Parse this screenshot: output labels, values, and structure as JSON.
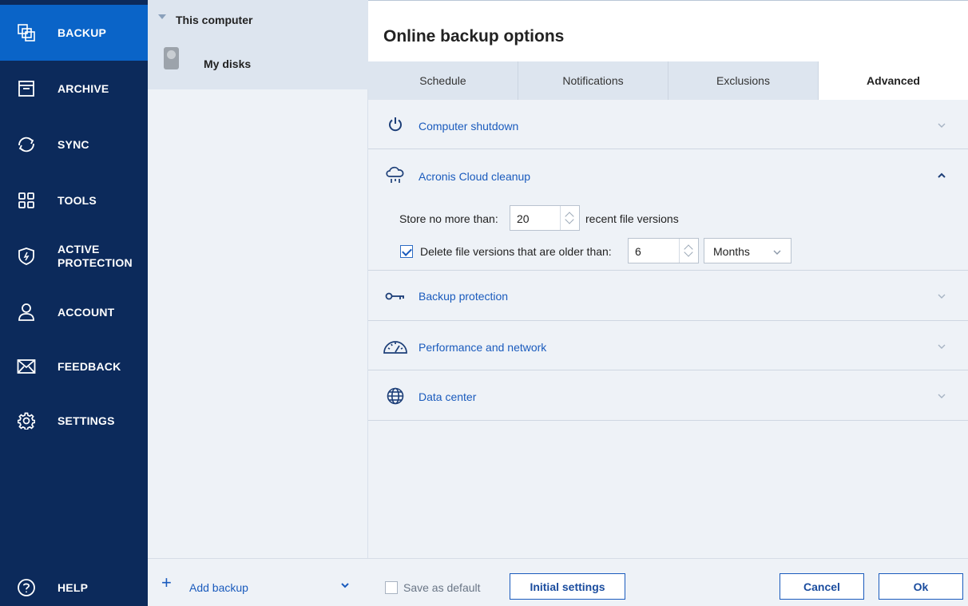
{
  "nav": {
    "items": [
      {
        "label": "BACKUP",
        "icon": "backup-icon",
        "active": true
      },
      {
        "label": "ARCHIVE",
        "icon": "archive-icon"
      },
      {
        "label": "SYNC",
        "icon": "sync-icon"
      },
      {
        "label": "TOOLS",
        "icon": "tools-icon"
      },
      {
        "label": "ACTIVE\nPROTECTION",
        "icon": "shield-icon"
      },
      {
        "label": "ACCOUNT",
        "icon": "user-icon"
      },
      {
        "label": "FEEDBACK",
        "icon": "envelope-icon"
      },
      {
        "label": "SETTINGS",
        "icon": "gear-icon"
      }
    ],
    "help_label": "HELP"
  },
  "sources": {
    "group_label": "This computer",
    "item_label": "My disks",
    "add_backup_label": "Add backup"
  },
  "options": {
    "title": "Online backup options",
    "tabs": [
      {
        "label": "Schedule"
      },
      {
        "label": "Notifications"
      },
      {
        "label": "Exclusions"
      },
      {
        "label": "Advanced",
        "active": true
      }
    ],
    "sections": {
      "shutdown": {
        "title": "Computer shutdown"
      },
      "cleanup": {
        "title": "Acronis Cloud cleanup",
        "store_label": "Store no more than:",
        "store_value": "20",
        "store_suffix": "recent file versions",
        "delete_label": "Delete file versions that are older than:",
        "delete_checked": true,
        "delete_value": "6",
        "delete_unit": "Months"
      },
      "protection": {
        "title": "Backup protection"
      },
      "performance": {
        "title": "Performance and network"
      },
      "datacenter": {
        "title": "Data center"
      }
    }
  },
  "footer": {
    "save_default_label": "Save as default",
    "initial_settings_label": "Initial settings",
    "cancel_label": "Cancel",
    "ok_label": "Ok"
  },
  "colors": {
    "nav_bg": "#0c2a5b",
    "nav_active": "#0a64c8",
    "accent": "#1a5bbd"
  }
}
